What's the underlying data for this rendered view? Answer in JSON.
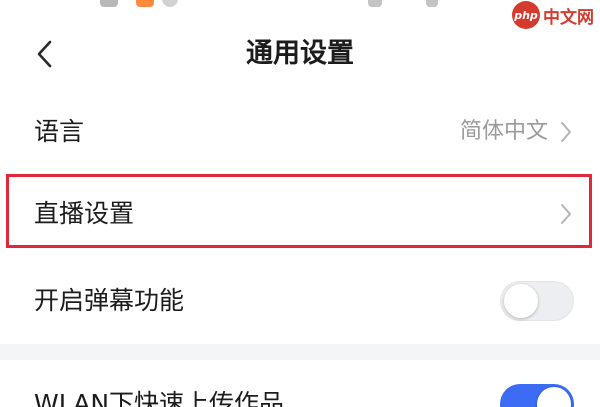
{
  "header": {
    "title": "通用设置"
  },
  "watermark": {
    "badge": "php",
    "text": "中文网"
  },
  "settings": [
    {
      "label": "语言",
      "value": "简体中文",
      "type": "nav"
    },
    {
      "label": "直播设置",
      "type": "nav",
      "highlighted": true
    },
    {
      "label": "开启弹幕功能",
      "type": "toggle",
      "enabled": false
    },
    {
      "label": "WLAN下快速上传作品",
      "type": "toggle",
      "enabled": true
    }
  ],
  "colors": {
    "highlight": "#e0283a",
    "toggle_on": "#3b6cf3",
    "toggle_off": "#eceef1",
    "section_gap": "#f4f5f7",
    "secondary_text": "#9a9a9a"
  }
}
